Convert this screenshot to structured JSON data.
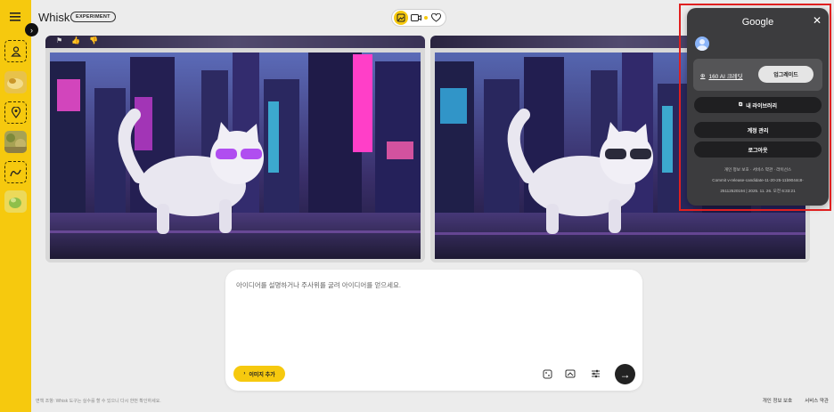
{
  "app": {
    "title": "Whisk",
    "badge": "EXPERIMENT"
  },
  "gallery": {
    "left_card_icons": [
      "flag-icon",
      "thumbs-up-icon",
      "thumbs-down-icon"
    ],
    "right_card_icons": [
      "trash-icon"
    ]
  },
  "prompt": {
    "placeholder": "아이디어를 설명하거나 주사위를 굴려 아이디어를 얻으세요.",
    "add_image_label": "이미지 추가"
  },
  "footer": {
    "disclaimer": "면책 조항: Whisk 도구는 실수를 할 수 있으니 다시 한번 확인하세요.",
    "privacy": "개인 정보 보호",
    "terms": "서비스 약관"
  },
  "account": {
    "title": "Google",
    "credits": "160 AI 크레딧",
    "upgrade": "업그레이드",
    "library": "내 라이브러리",
    "manage": "계정 관리",
    "logout": "로그아웃",
    "legal_line": "개인 정보 보호 · 서비스 약관 · 라이선스",
    "commit_line": "Commit v-release-candidate-11-20-25-11b9044c8-",
    "build_line": "25112520194 | 2025. 11. 26. 오전 6:33:21"
  },
  "colors": {
    "accent": "#f6c90e",
    "panel": "#3c3c3e",
    "highlight": "#e02020"
  }
}
